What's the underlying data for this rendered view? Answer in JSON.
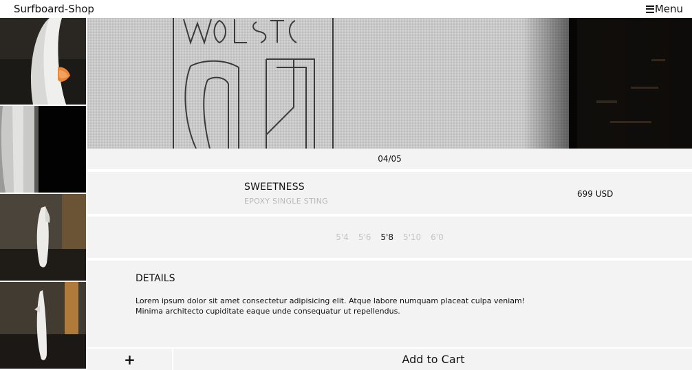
{
  "header": {
    "brand": "Surfboard-Shop",
    "menu_label": "Menu",
    "menu_icon": "hamburger-icon"
  },
  "gallery": {
    "counter": "04/05",
    "thumbnails": [
      "surfboard-nose-closeup",
      "surfboard-rail-dark",
      "surfboard-standing-front",
      "surfboard-standing-side"
    ],
    "hero": "surfboard-logo-closeup"
  },
  "product": {
    "name": "SWEETNESS",
    "subtitle": "EPOXY SINGLE STING",
    "price": "699 USD"
  },
  "sizes": {
    "options": [
      "5'4",
      "5'6",
      "5'8",
      "5'10",
      "6'0"
    ],
    "selected": "5'8"
  },
  "details": {
    "title": "DETAILS",
    "text": "Lorem ipsum dolor sit amet consectetur adipisicing elit. Atque labore numquam placeat culpa veniam! Minima architecto cupiditate eaque unde consequatur ut repellendus."
  },
  "cart": {
    "plus_label": "+",
    "add_label": "Add to Cart"
  }
}
